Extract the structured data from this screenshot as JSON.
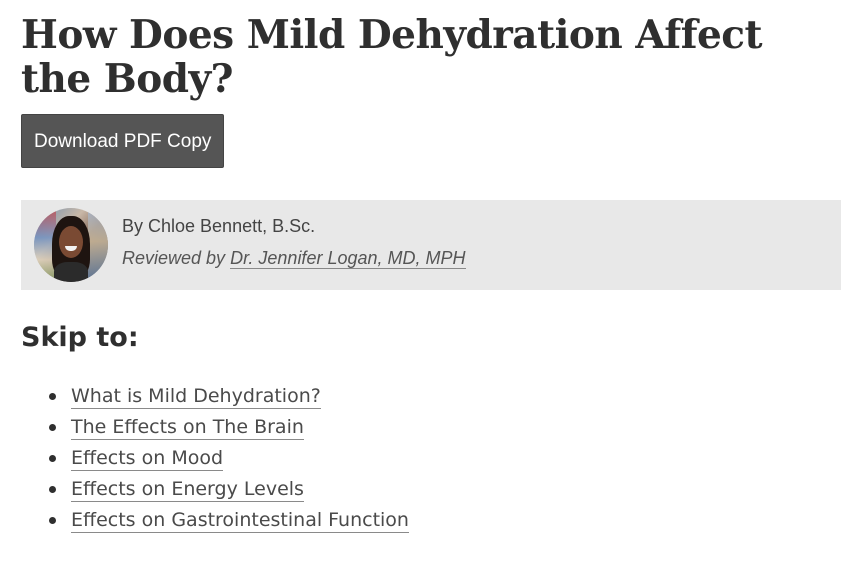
{
  "article": {
    "title": "How Does Mild Dehydration Affect the Body?",
    "download_label": "Download PDF Copy"
  },
  "byline": {
    "author": "By Chloe Bennett, B.Sc.",
    "reviewed_prefix": "Reviewed by",
    "reviewer": "Dr. Jennifer Logan, MD, MPH"
  },
  "skip_to": {
    "heading": "Skip to:",
    "items": [
      {
        "label": "What is Mild Dehydration?"
      },
      {
        "label": "The Effects on The Brain"
      },
      {
        "label": "Effects on Mood"
      },
      {
        "label": "Effects on Energy Levels"
      },
      {
        "label": "Effects on Gastrointestinal Function"
      }
    ]
  }
}
